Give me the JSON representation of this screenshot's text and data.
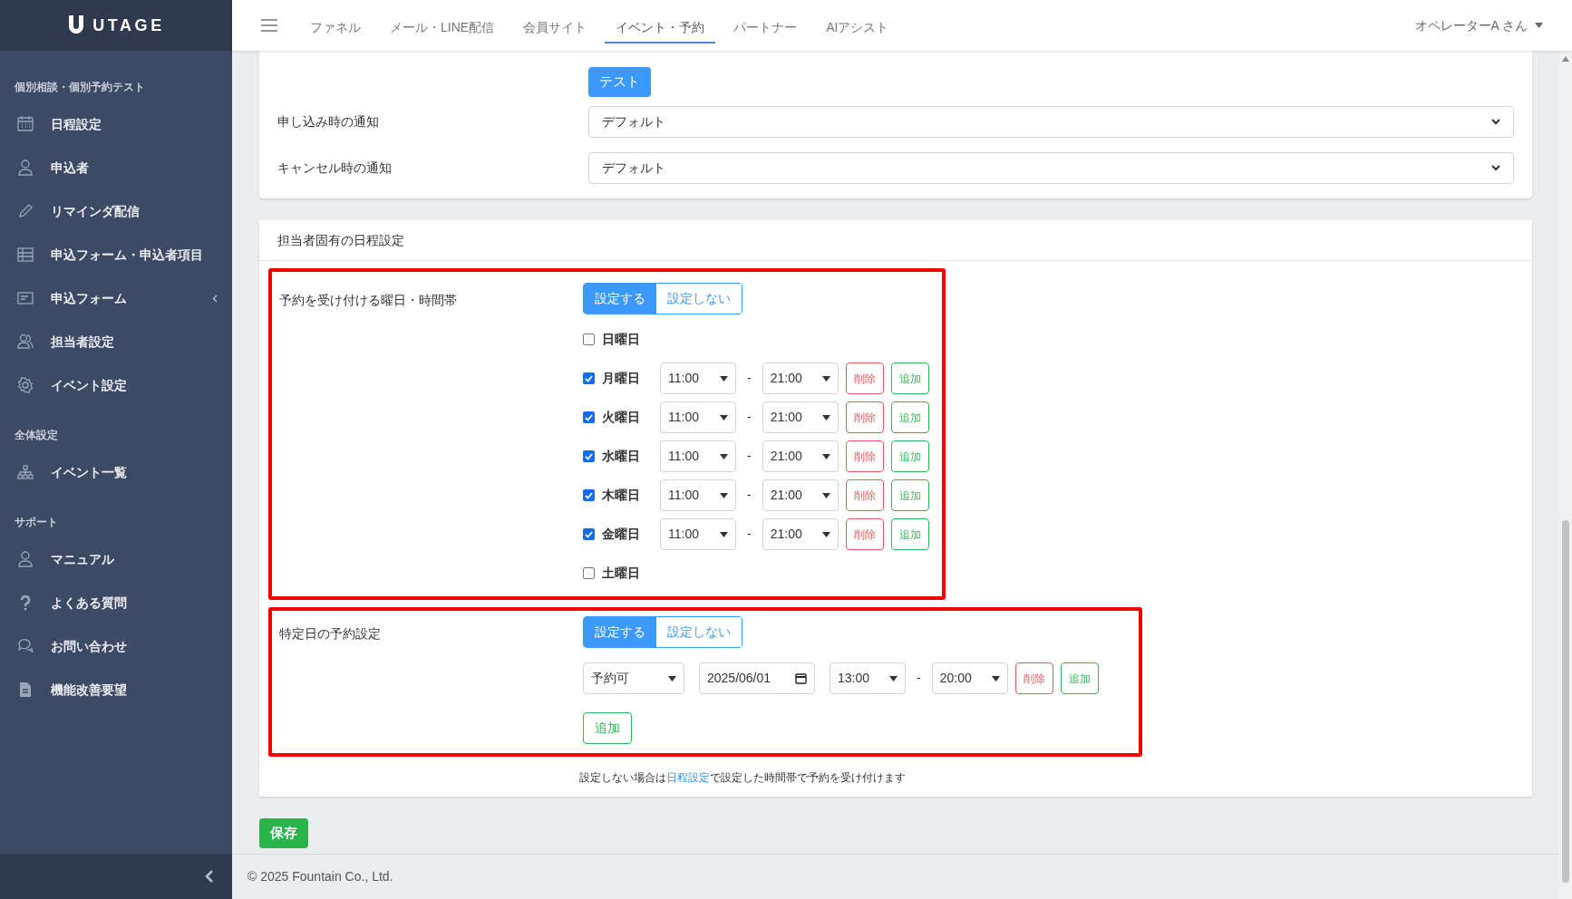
{
  "brand": "UTAGE",
  "sidebar": {
    "sections": [
      {
        "title": "個別相談・個別予約テスト",
        "items": [
          {
            "label": "日程設定",
            "expandable": false
          },
          {
            "label": "申込者",
            "expandable": false
          },
          {
            "label": "リマインダ配信",
            "expandable": false
          },
          {
            "label": "申込フォーム・申込者項目",
            "expandable": false
          },
          {
            "label": "申込フォーム",
            "expandable": true
          },
          {
            "label": "担当者設定",
            "expandable": false
          },
          {
            "label": "イベント設定",
            "expandable": false
          }
        ]
      },
      {
        "title": "全体設定",
        "items": [
          {
            "label": "イベント一覧",
            "expandable": false
          }
        ]
      },
      {
        "title": "サポート",
        "items": [
          {
            "label": "マニュアル",
            "expandable": false
          },
          {
            "label": "よくある質問",
            "expandable": false
          },
          {
            "label": "お問い合わせ",
            "expandable": false
          },
          {
            "label": "機能改善要望",
            "expandable": false
          }
        ]
      }
    ]
  },
  "nav": {
    "tabs": [
      {
        "label": "ファネル",
        "selected": false
      },
      {
        "label": "メール・LINE配信",
        "selected": false
      },
      {
        "label": "会員サイト",
        "selected": false
      },
      {
        "label": "イベント・予約",
        "selected": true
      },
      {
        "label": "パートナー",
        "selected": false
      },
      {
        "label": "AIアシスト",
        "selected": false
      }
    ],
    "user": "オペレーターA さん"
  },
  "notify_card": {
    "test_button": "テスト",
    "fields": [
      {
        "label": "申し込み時の通知",
        "value": "デフォルト"
      },
      {
        "label": "キャンセル時の通知",
        "value": "デフォルト"
      }
    ]
  },
  "schedule_card": {
    "title": "担当者固有の日程設定",
    "weekly": {
      "label": "予約を受け付ける曜日・時間帯",
      "toggle": [
        {
          "label": "設定する",
          "selected": true
        },
        {
          "label": "設定しない",
          "selected": false
        }
      ],
      "days": [
        {
          "label": "日曜日",
          "checked": false
        },
        {
          "label": "月曜日",
          "checked": true,
          "slots": [
            {
              "start": "11:00",
              "separator": "-",
              "end": "21:00",
              "delete": "削除",
              "add": "追加"
            }
          ]
        },
        {
          "label": "火曜日",
          "checked": true,
          "slots": [
            {
              "start": "11:00",
              "separator": "-",
              "end": "21:00",
              "delete": "削除",
              "add": "追加"
            }
          ]
        },
        {
          "label": "水曜日",
          "checked": true,
          "slots": [
            {
              "start": "11:00",
              "separator": "-",
              "end": "21:00",
              "delete": "削除",
              "add": "追加"
            }
          ]
        },
        {
          "label": "木曜日",
          "checked": true,
          "slots": [
            {
              "start": "11:00",
              "separator": "-",
              "end": "21:00",
              "delete": "削除",
              "add": "追加"
            }
          ]
        },
        {
          "label": "金曜日",
          "checked": true,
          "slots": [
            {
              "start": "11:00",
              "separator": "-",
              "end": "21:00",
              "delete": "削除",
              "add": "追加"
            }
          ]
        },
        {
          "label": "土曜日",
          "checked": false
        }
      ]
    },
    "specific": {
      "label": "特定日の予約設定",
      "toggle": [
        {
          "label": "設定する",
          "selected": true
        },
        {
          "label": "設定しない",
          "selected": false
        }
      ],
      "rows": [
        {
          "status": "予約可",
          "date": "2025/06/01",
          "start": "13:00",
          "end": "20:00"
        }
      ],
      "separator": "-",
      "delete_label": "削除",
      "add_label": "追加",
      "add_row_button": "追加"
    },
    "help": {
      "before": "設定しない場合は",
      "link": "日程設定",
      "after": "で設定した時間帯で予約を受け付けます"
    }
  },
  "save_button": "保存",
  "footer": "© 2025 Fountain Co., Ltd."
}
